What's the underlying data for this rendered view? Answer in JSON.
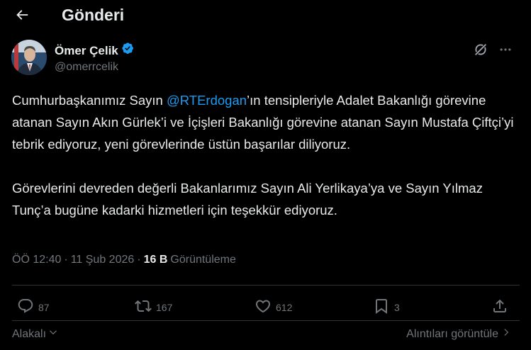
{
  "header": {
    "title": "Gönderi",
    "back_icon": "arrow-left-icon"
  },
  "author": {
    "name": "Ömer Çelik",
    "handle": "@omerrcelik",
    "verified_icon": "verified-badge-icon",
    "verified_color": "#1d9bf0"
  },
  "tweet": {
    "p1_before": "Cumhurbaşkanımız Sayın ",
    "mention": "@RTErdogan",
    "p1_after": "’ın tensipleriyle Adalet Bakanlığı görevine atanan Sayın Akın Gürlek’i ve İçişleri Bakanlığı görevine atanan Sayın Mustafa Çiftçi’yi tebrik ediyoruz, yeni görevlerinde üstün başarılar diliyoruz.",
    "p2": "Görevlerini devreden değerli Bakanlarımız Sayın Ali Yerlikaya’ya ve Sayın Yılmaz Tunç’a bugüne kadarki hizmetleri için teşekkür ediyoruz."
  },
  "meta": {
    "time": "ÖÖ 12:40",
    "separator": "·",
    "date": "11 Şub 2026",
    "views_count": "16 B",
    "views_label": "Görüntüleme"
  },
  "actions": {
    "reply_count": "87",
    "repost_count": "167",
    "like_count": "612",
    "bookmark_count": "3"
  },
  "footer": {
    "sort_label": "Alakalı",
    "quotes_label": "Alıntıları görüntüle"
  },
  "colors": {
    "background": "#000000",
    "text": "#e7e9ea",
    "secondary": "#71767b",
    "accent": "#1d9bf0",
    "border": "#2f3336"
  }
}
